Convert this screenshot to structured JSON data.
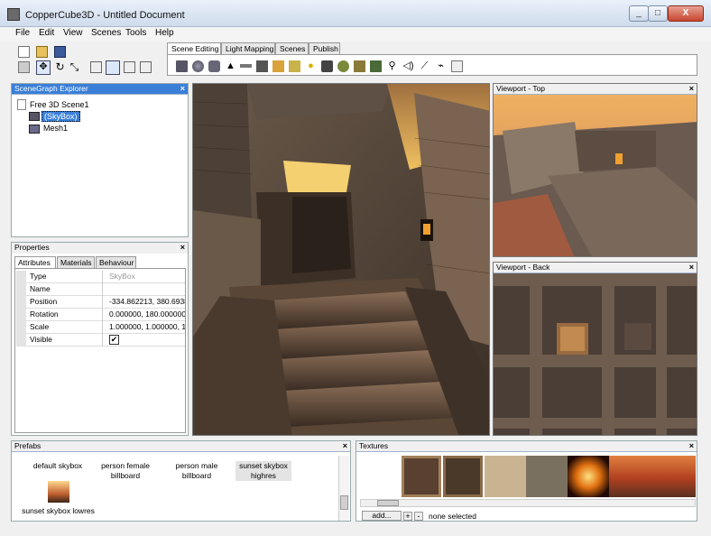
{
  "window": {
    "title": "CopperCube3D - Untitled Document",
    "buttons": [
      "_",
      "□",
      "X"
    ]
  },
  "menu": [
    "File",
    "Edit",
    "View",
    "Scenes",
    "Tools",
    "Help"
  ],
  "toolbar": {
    "tabs": [
      "Scene Editing",
      "Light Mapping",
      "Scenes",
      "Publish"
    ],
    "selected_tab": "Scene Editing"
  },
  "scenegraph": {
    "title": "SceneGraph Explorer",
    "close": "×",
    "root": "Free 3D Scene1",
    "items": [
      "(SkyBox)",
      "Mesh1"
    ],
    "selected": "(SkyBox)"
  },
  "properties": {
    "title": "Properties",
    "close": "×",
    "tabs": [
      "Attributes",
      "Materials",
      "Behaviour"
    ],
    "rows": [
      {
        "key": "Type",
        "value": "SkyBox"
      },
      {
        "key": "Name",
        "value": ""
      },
      {
        "key": "Position",
        "value": "-334.862213, 380.6938"
      },
      {
        "key": "Rotation",
        "value": "0.000000, 180.000000,"
      },
      {
        "key": "Scale",
        "value": "1.000000, 1.000000, 1."
      },
      {
        "key": "Visible",
        "value": "✔"
      }
    ]
  },
  "viewports": {
    "top": {
      "title": "Viewport - Top",
      "close": "×"
    },
    "back": {
      "title": "Viewport - Back",
      "close": "×"
    }
  },
  "prefabs": {
    "title": "Prefabs",
    "close": "×",
    "items": [
      "default skybox",
      "person female billboard",
      "person male billboard",
      "sunset skybox highres",
      "sunset skybox lowres"
    ],
    "selected": "sunset skybox highres"
  },
  "textures": {
    "title": "Textures",
    "close": "×",
    "add_label": "add...",
    "plus": "+",
    "minus": "-",
    "status": "none selected"
  },
  "colors": {
    "accent": "#3a7fd8",
    "panel_header": "#cfe0f5"
  }
}
